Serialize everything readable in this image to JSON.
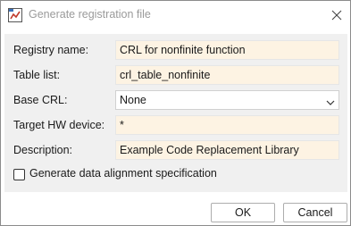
{
  "window": {
    "title": "Generate registration file",
    "icon": "matlab-app-icon",
    "close_icon": "close-icon"
  },
  "form": {
    "registry_name": {
      "label": "Registry name:",
      "value": "CRL for nonfinite function"
    },
    "table_list": {
      "label": "Table list:",
      "value": "crl_table_nonfinite"
    },
    "base_crl": {
      "label": "Base CRL:",
      "value": "None"
    },
    "target_hw": {
      "label": "Target HW device:",
      "value": "*"
    },
    "description": {
      "label": "Description:",
      "value": "Example Code Replacement Library"
    },
    "alignment": {
      "label": "Generate data alignment specification",
      "checked": false
    }
  },
  "buttons": {
    "ok": "OK",
    "cancel": "Cancel"
  },
  "colors": {
    "field_bg": "#fdf3e3",
    "panel_bg": "#f0f0f0"
  }
}
